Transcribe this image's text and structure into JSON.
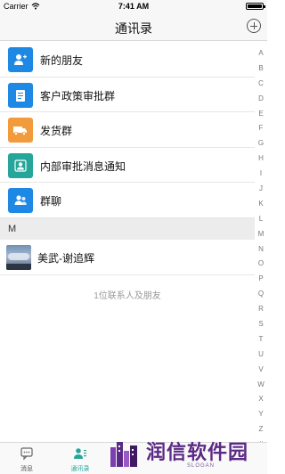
{
  "status_bar": {
    "carrier": "Carrier",
    "time": "7:41 AM"
  },
  "nav": {
    "title": "通讯录"
  },
  "function_rows": [
    {
      "label": "新的朋友",
      "icon": "add-friend-icon",
      "color": "#1e88e5"
    },
    {
      "label": "客户政策审批群",
      "icon": "clipboard-icon",
      "color": "#1e88e5"
    },
    {
      "label": "发货群",
      "icon": "truck-icon",
      "color": "#f29b3c"
    },
    {
      "label": "内部审批消息通知",
      "icon": "person-card-icon",
      "color": "#26a69a"
    },
    {
      "label": "群聊",
      "icon": "group-chat-icon",
      "color": "#1e88e5"
    }
  ],
  "section": {
    "letter": "M"
  },
  "contacts": [
    {
      "name": "美武-谢追辉"
    }
  ],
  "summary": "1位联系人及朋友",
  "alphabet": [
    "A",
    "B",
    "C",
    "D",
    "E",
    "F",
    "G",
    "H",
    "I",
    "J",
    "K",
    "L",
    "M",
    "N",
    "O",
    "P",
    "Q",
    "R",
    "S",
    "T",
    "U",
    "V",
    "W",
    "X",
    "Y",
    "Z",
    "#"
  ],
  "tabs": [
    {
      "label": "消息",
      "icon": "message-icon",
      "active": false
    },
    {
      "label": "通讯录",
      "icon": "contacts-icon",
      "active": true
    }
  ],
  "watermark": {
    "text": "润信软件园",
    "slogan": "SLOGAN"
  },
  "colors": {
    "accent": "#1e88e5",
    "active_tab": "#26a69a"
  }
}
